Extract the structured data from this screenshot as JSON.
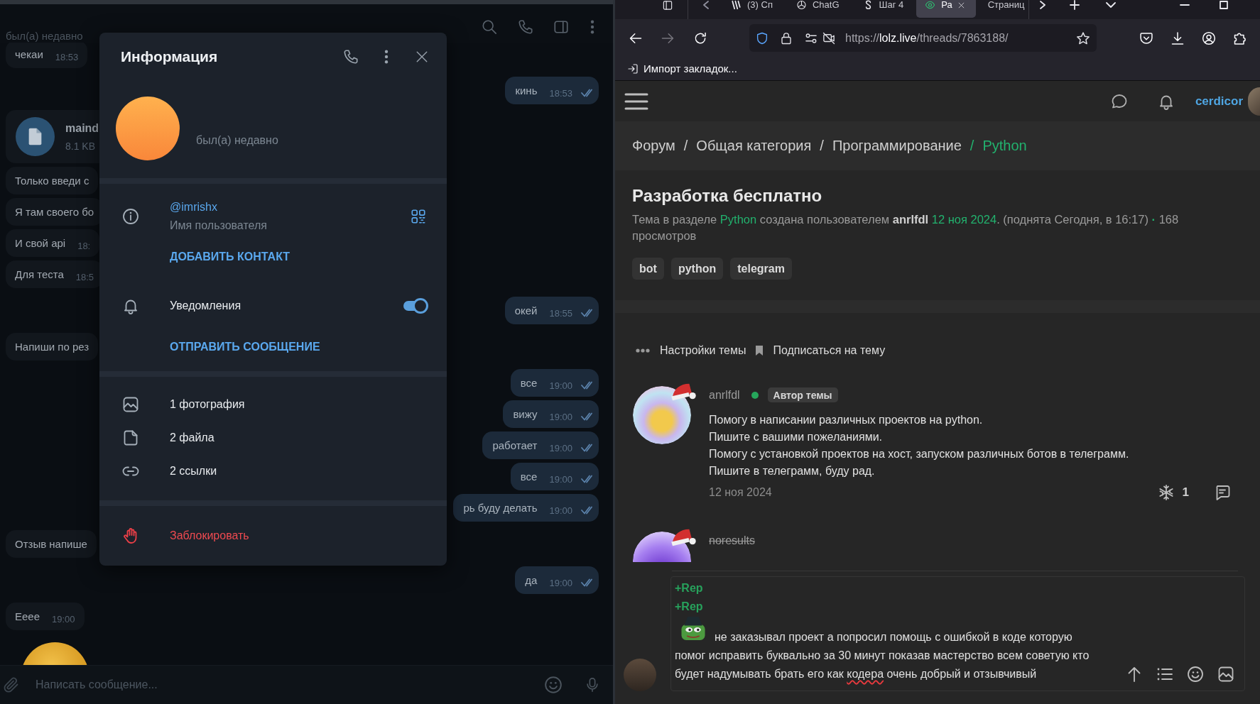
{
  "telegram": {
    "chat_header": {
      "status": "был(а) недавно"
    },
    "messages": [
      {
        "kind": "text",
        "outgoing": false,
        "text": "чекаи",
        "time": "18:53"
      },
      {
        "kind": "text",
        "outgoing": true,
        "text": "кинь",
        "time": "18:53",
        "read": true
      },
      {
        "kind": "file",
        "outgoing": false,
        "name": "maind",
        "size": "8.1 KB"
      },
      {
        "kind": "text",
        "outgoing": false,
        "text": "Только введи с"
      },
      {
        "kind": "text",
        "outgoing": false,
        "text": "Я там своего бо"
      },
      {
        "kind": "text",
        "outgoing": false,
        "text": "И свой api",
        "time": "18:"
      },
      {
        "kind": "text",
        "outgoing": false,
        "text": "Для теста",
        "time": "18:5"
      },
      {
        "kind": "text",
        "outgoing": true,
        "text": "окей",
        "time": "18:55",
        "read": true
      },
      {
        "kind": "text",
        "outgoing": false,
        "text": "Напиши по рез"
      },
      {
        "kind": "text",
        "outgoing": true,
        "text": "все",
        "time": "19:00",
        "read": true
      },
      {
        "kind": "text",
        "outgoing": true,
        "text": "вижу",
        "time": "19:00",
        "read": true
      },
      {
        "kind": "text",
        "outgoing": true,
        "text": "работает",
        "time": "19:00",
        "read": true
      },
      {
        "kind": "text",
        "outgoing": true,
        "text": "все",
        "time": "19:00",
        "read": true
      },
      {
        "kind": "text",
        "outgoing": true,
        "text": "рь буду делать",
        "time": "19:00",
        "read": true
      },
      {
        "kind": "text",
        "outgoing": false,
        "text": "Отзыв напише"
      },
      {
        "kind": "text",
        "outgoing": true,
        "text": "да",
        "time": "19:00",
        "read": true
      },
      {
        "kind": "text",
        "outgoing": false,
        "text": "Eeee",
        "time": "19:00"
      },
      {
        "kind": "sticker"
      }
    ],
    "composer": {
      "placeholder": "Написать сообщение..."
    },
    "info_panel": {
      "title": "Информация",
      "status": "был(а) недавно",
      "username": "@imrishx",
      "username_caption": "Имя пользователя",
      "add_contact": "ДОБАВИТЬ КОНТАКТ",
      "notifications": {
        "label": "Уведомления",
        "on": true
      },
      "send_message": "ОТПРАВИТЬ СООБЩЕНИЕ",
      "media": [
        {
          "kind": "photos",
          "label": "1 фотография"
        },
        {
          "kind": "files",
          "label": "2 файла"
        },
        {
          "kind": "links",
          "label": "2 ссылки"
        }
      ],
      "block": "Заблокировать"
    }
  },
  "browser": {
    "tabs": [
      {
        "title": "(3) Сп",
        "selected": false
      },
      {
        "title": "ChatG",
        "selected": false
      },
      {
        "title": "Шаг 4",
        "selected": false
      },
      {
        "title": "Ра",
        "selected": true
      },
      {
        "title": "Страниц",
        "selected": false
      }
    ],
    "navigation": [
      {
        "kind": "back",
        "disabled": false
      },
      {
        "kind": "forward",
        "disabled": true
      }
    ],
    "address": {
      "scheme": "https://",
      "host": "lolz.live",
      "path": "/threads/7863188/"
    },
    "bookmarks": [
      {
        "label": "Импорт закладок..."
      }
    ]
  },
  "site": {
    "header": {
      "user": "cerdicor"
    },
    "breadcrumbs": [
      {
        "label": "Форум",
        "current": false
      },
      {
        "separator": "/",
        "label": "Общая категория",
        "current": false
      },
      {
        "separator": "/",
        "label": "Программирование",
        "current": false
      },
      {
        "separator": "/",
        "label": "Python",
        "current": true
      }
    ],
    "thread": {
      "title": "Разработка бесплатно",
      "meta": [
        {
          "kind": "text",
          "text": "Тема в разделе "
        },
        {
          "kind": "link",
          "text": "Python"
        },
        {
          "kind": "text",
          "text": " создана пользователем **anrlfdl** "
        },
        {
          "kind": "link",
          "text": "12 ноя 2024"
        },
        {
          "kind": "text",
          "text": ". (поднята Сегодня, в 16:17) "
        },
        {
          "kind": "dot",
          "text": "·"
        },
        {
          "kind": "text",
          "text": " 168 просмотров"
        }
      ],
      "tags": [
        "bot",
        "python",
        "telegram"
      ]
    },
    "thread_tools": [
      {
        "kind": "settings",
        "label": "Настройки темы"
      },
      {
        "kind": "subscribe",
        "label": "Подписаться на тему"
      }
    ],
    "posts": [
      {
        "author": "anrlfdl",
        "online": true,
        "banned": false,
        "badge": "Автор темы",
        "lines": [
          "Помогу в написании различных проектов на python.",
          "Пишите с вашими пожеланиями.",
          "Помогу с установкой проектов на хост, запуском различных ботов в телеграмм.",
          "Пишите в телеграмм, буду рад."
        ],
        "date": "12 ноя 2024",
        "likes": "1"
      },
      {
        "author": "noresults",
        "online": false,
        "banned": true
      }
    ],
    "reply_editor": {
      "rep_lines": [
        "+Rep",
        "+Rep"
      ],
      "text_lines": [
        [
          {
            "text": "не заказывал проект а попросил помощь с ошибкой в коде которую",
            "misspelled": false
          }
        ],
        [
          {
            "text": "помог исправить буквально за 30 минут показав мастерство всем советую кто",
            "misspelled": false
          }
        ],
        [
          {
            "text": "будет надумывать брать его как ",
            "misspelled": false
          },
          {
            "text": "кодера",
            "misspelled": true
          },
          {
            "text": " очень добрый и отзывчивый",
            "misspelled": false
          }
        ]
      ]
    }
  }
}
